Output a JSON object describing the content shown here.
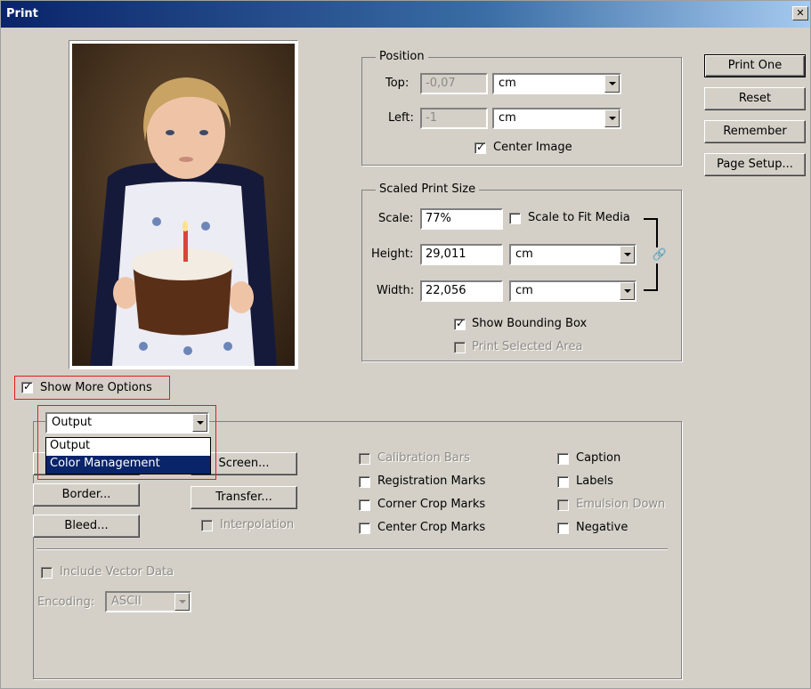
{
  "window": {
    "title": "Print",
    "close_icon": "close-icon"
  },
  "position": {
    "legend": "Position",
    "top_label": "Top:",
    "top_value": "-0,07",
    "top_unit": "cm",
    "left_label": "Left:",
    "left_value": "-1",
    "left_unit": "cm",
    "center_image_label": "Center Image",
    "center_image_checked": true
  },
  "scaled": {
    "legend": "Scaled Print Size",
    "scale_label": "Scale:",
    "scale_value": "77%",
    "scale_to_fit_label": "Scale to Fit Media",
    "scale_to_fit_checked": false,
    "height_label": "Height:",
    "height_value": "29,011",
    "height_unit": "cm",
    "width_label": "Width:",
    "width_value": "22,056",
    "width_unit": "cm",
    "link_icon": "chain-link-icon",
    "show_bounding_box_label": "Show Bounding Box",
    "show_bounding_box_checked": true,
    "print_selected_area_label": "Print Selected Area",
    "print_selected_area_checked": false
  },
  "buttons": {
    "print_one": "Print One",
    "reset": "Reset",
    "remember": "Remember",
    "page_setup": "Page Setup..."
  },
  "show_more_options": {
    "label": "Show More Options",
    "checked": true
  },
  "output": {
    "selected": "Output",
    "options": [
      "Output",
      "Color Management"
    ],
    "highlighted_option": "Color Management",
    "screen_button": "Screen...",
    "border_button": "Border...",
    "transfer_button": "Transfer...",
    "bleed_button": "Bleed...",
    "interpolation_label": "Interpolation",
    "calibration_bars_label": "Calibration Bars",
    "registration_marks_label": "Registration Marks",
    "corner_crop_marks_label": "Corner Crop Marks",
    "center_crop_marks_label": "Center Crop Marks",
    "caption_label": "Caption",
    "labels_label": "Labels",
    "emulsion_down_label": "Emulsion Down",
    "negative_label": "Negative",
    "include_vector_data_label": "Include Vector Data",
    "encoding_label": "Encoding:",
    "encoding_value": "ASCII"
  },
  "colors": {
    "accent": "#0a246a",
    "highlight_box": "#e21d1d",
    "dialog_bg": "#d4d0c8"
  }
}
